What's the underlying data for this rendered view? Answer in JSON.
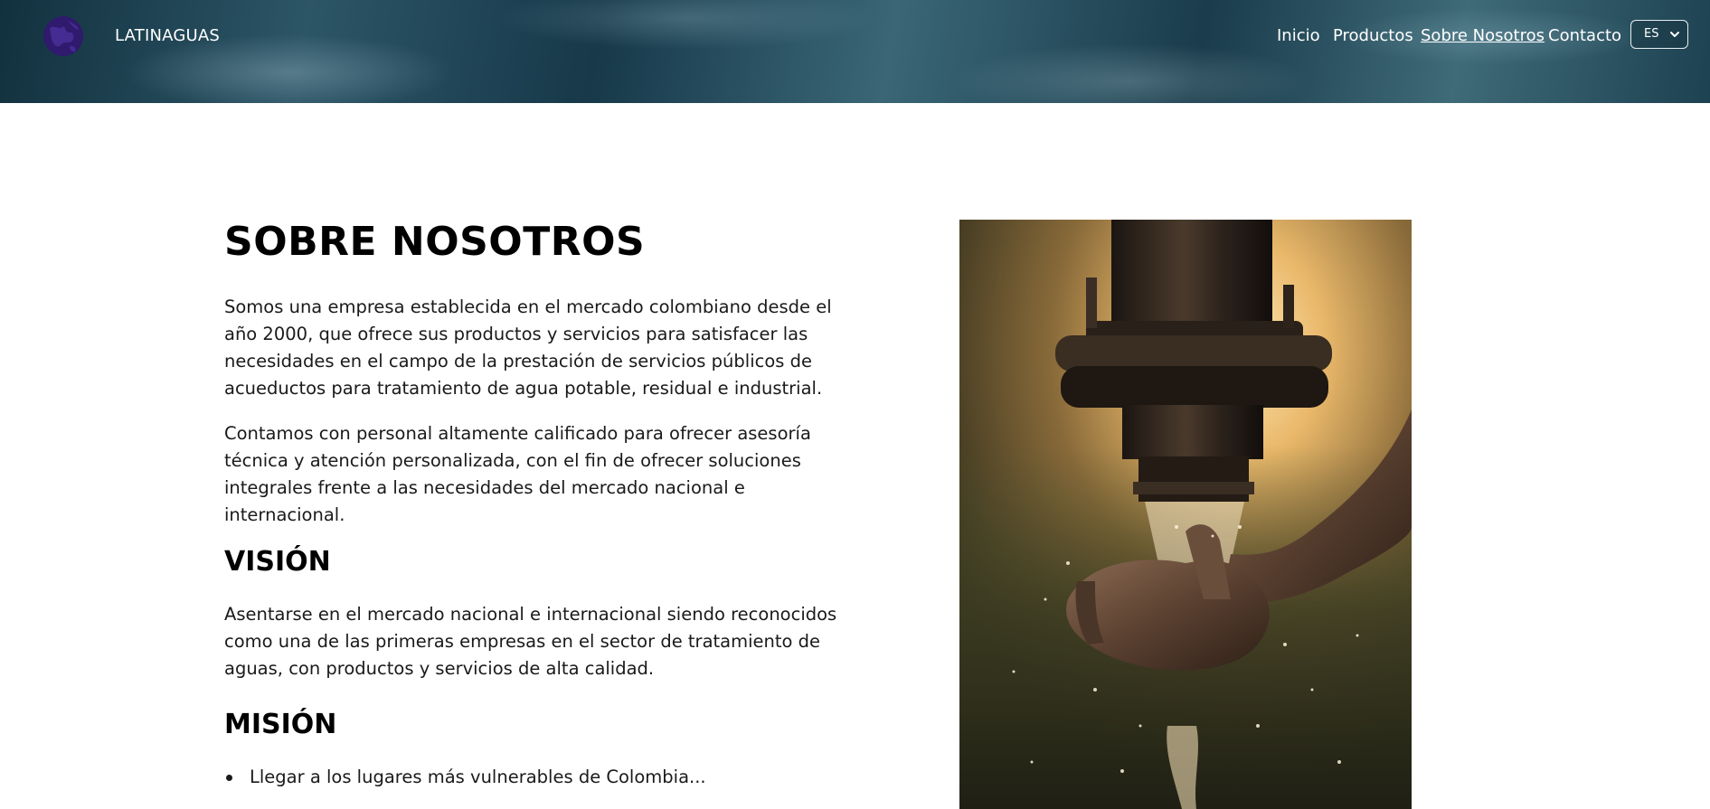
{
  "header": {
    "brand": "LATINAGUAS",
    "nav": [
      {
        "label": "Inicio",
        "active": false
      },
      {
        "label": "Productos",
        "active": false
      },
      {
        "label": "Sobre Nosotros",
        "active": true
      },
      {
        "label": "Contacto",
        "active": false
      }
    ],
    "language": {
      "selected": "ES"
    }
  },
  "main": {
    "title": "SOBRE NOSOTROS",
    "intro": [
      "Somos una empresa establecida en el mercado colombiano desde el año 2000, que ofrece sus productos y servicios para satisfacer las necesidades en el campo de la prestación de servicios públicos de acueductos para tratamiento de agua potable, residual e industrial.",
      "Contamos con personal altamente calificado para ofrecer asesoría técnica y atención personalizada, con el fin de ofrecer soluciones integrales frente a las necesidades del mercado nacional e internacional."
    ],
    "vision": {
      "heading": "VISIÓN",
      "text": "Asentarse en el mercado nacional e internacional siendo reconocidos como una de las primeras empresas en el sector de tratamiento de aguas, con productos y servicios de alta calidad."
    },
    "mision": {
      "heading": "MISIÓN",
      "items": [
        "Llegar a los lugares más vulnerables de Colombia..."
      ]
    }
  },
  "colors": {
    "header_bg": "#1d4252",
    "logo": "#3a1f7a",
    "text": "#1a1a1a"
  },
  "icons": {
    "logo": "globe-logo-icon",
    "lang_chevron": "chevron-down-icon"
  }
}
